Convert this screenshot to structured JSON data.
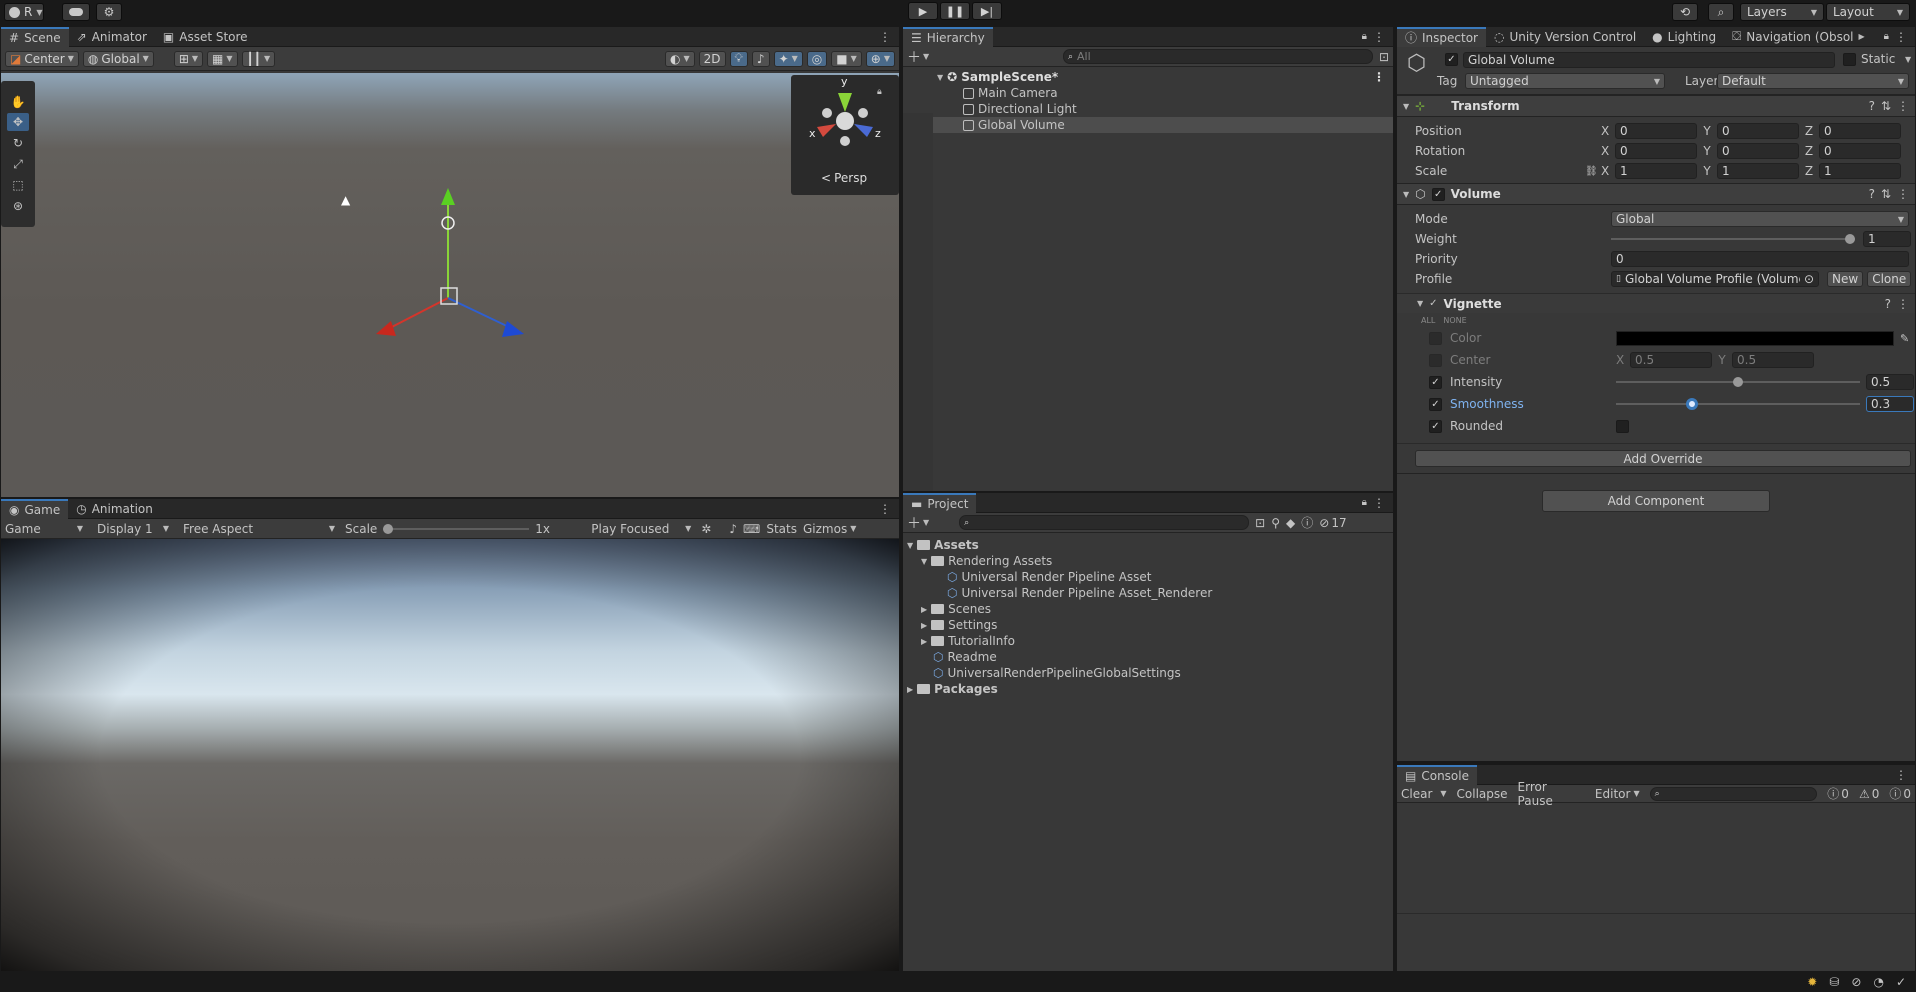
{
  "topbar": {
    "account_label": "R",
    "layers": "Layers",
    "layout": "Layout"
  },
  "scene_tabs": [
    {
      "label": "Scene"
    },
    {
      "label": "Animator"
    },
    {
      "label": "Asset Store"
    }
  ],
  "scene_toolbar": {
    "pivot": "Center",
    "space": "Global",
    "mode_2d": "2D"
  },
  "gizmo": {
    "persp": "Persp",
    "x": "x",
    "y": "y",
    "z": "z"
  },
  "game_tabs": [
    {
      "label": "Game"
    },
    {
      "label": "Animation"
    }
  ],
  "game_toolbar": {
    "view": "Game",
    "display": "Display 1",
    "aspect": "Free Aspect",
    "scale_label": "Scale",
    "scale_value": "1x",
    "play_mode": "Play Focused",
    "stats": "Stats",
    "gizmos": "Gizmos",
    "scale_fraction": 0.0
  },
  "hierarchy": {
    "tab": "Hierarchy",
    "search_placeholder": "All",
    "scene": "SampleScene*",
    "items": [
      "Main Camera",
      "Directional Light",
      "Global Volume"
    ]
  },
  "project": {
    "tab": "Project",
    "hidden_count": "17",
    "tree": {
      "assets": "Assets",
      "rendering_assets": "Rendering Assets",
      "urp_asset": "Universal Render Pipeline Asset",
      "urp_renderer": "Universal Render Pipeline Asset_Renderer",
      "scenes": "Scenes",
      "settings": "Settings",
      "tutorial": "TutorialInfo",
      "readme": "Readme",
      "global_settings": "UniversalRenderPipelineGlobalSettings",
      "packages": "Packages"
    }
  },
  "inspector": {
    "tabs": [
      {
        "label": "Inspector"
      },
      {
        "label": "Unity Version Control"
      },
      {
        "label": "Lighting"
      },
      {
        "label": "Navigation (Obsol"
      }
    ],
    "object_name": "Global Volume",
    "static_label": "Static",
    "tag_label": "Tag",
    "tag_value": "Untagged",
    "layer_label": "Layer",
    "layer_value": "Default",
    "transform": {
      "title": "Transform",
      "rows": [
        {
          "label": "Position",
          "x": "0",
          "y": "0",
          "z": "0"
        },
        {
          "label": "Rotation",
          "x": "0",
          "y": "0",
          "z": "0"
        },
        {
          "label": "Scale",
          "x": "1",
          "y": "1",
          "z": "1"
        }
      ],
      "axis_x": "X",
      "axis_y": "Y",
      "axis_z": "Z"
    },
    "volume": {
      "title": "Volume",
      "mode_label": "Mode",
      "mode_value": "Global",
      "weight_label": "Weight",
      "weight_value": "1",
      "weight_fraction": 1.0,
      "priority_label": "Priority",
      "priority_value": "0",
      "profile_label": "Profile",
      "profile_value": "Global Volume Profile (Volume",
      "new_btn": "New",
      "clone_btn": "Clone"
    },
    "vignette": {
      "title": "Vignette",
      "all": "ALL",
      "none": "NONE",
      "color_label": "Color",
      "center_label": "Center",
      "center_x": "0.5",
      "center_y": "0.5",
      "intensity_label": "Intensity",
      "intensity_value": "0.5",
      "intensity_fraction": 0.5,
      "smoothness_label": "Smoothness",
      "smoothness_value": "0.3",
      "smoothness_fraction": 0.3,
      "rounded_label": "Rounded"
    },
    "add_override": "Add Override",
    "add_component": "Add Component"
  },
  "console": {
    "tab": "Console",
    "clear": "Clear",
    "collapse": "Collapse",
    "error_pause": "Error Pause",
    "editor": "Editor",
    "log_count": "0",
    "warn_count": "0",
    "error_count": "0"
  },
  "colors": {
    "accent": "#3a79bb",
    "selection": "#4d4d4d"
  }
}
